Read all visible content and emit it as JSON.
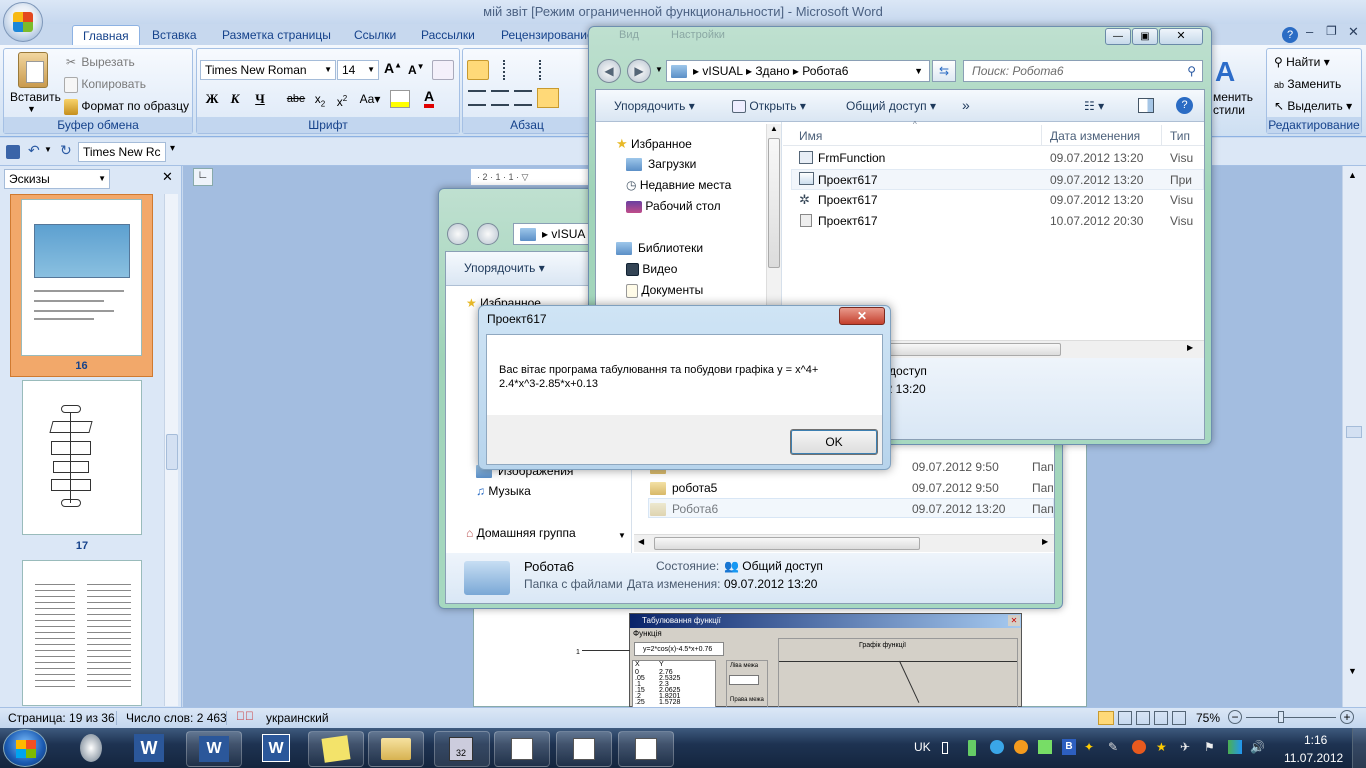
{
  "window": {
    "title": "мій звіт [Режим ограниченной функциональности] - Microsoft Word"
  },
  "ribbon": {
    "tabs": [
      "Главная",
      "Вставка",
      "Разметка страницы",
      "Ссылки",
      "Рассылки",
      "Рецензирование"
    ],
    "clipboard": {
      "paste": "Вставить",
      "cut": "Вырезать",
      "copy": "Копировать",
      "format_painter": "Формат по образцу",
      "label": "Буфер обмена"
    },
    "font": {
      "name": "Times New Roman",
      "size": "14",
      "label": "Шрифт"
    },
    "paragraph": {
      "label": "Абзац"
    },
    "styles": {
      "change": "менить",
      "change2": "стили"
    },
    "editing": {
      "find": "Найти",
      "replace": "Заменить",
      "select": "Выделить",
      "label": "Редактирование"
    }
  },
  "qat": {
    "font_name": "Times New Rc"
  },
  "left_pane": {
    "mode": "Эскизы",
    "pages": [
      "16",
      "17"
    ]
  },
  "explorer1": {
    "path": [
      "vISUAL",
      "Здано",
      "Робота6"
    ],
    "search_placeholder": "Поиск: Робота6",
    "menu": {
      "organize": "Упорядочить",
      "open": "Открыть",
      "share": "Общий доступ",
      "more": "»"
    },
    "nav": {
      "favorites": "Избранное",
      "downloads": "Загрузки",
      "recent": "Недавние места",
      "desktop": "Рабочий стол",
      "libraries": "Библиотеки",
      "video": "Видео",
      "documents": "Документы"
    },
    "columns": {
      "name": "Имя",
      "date": "Дата изменения",
      "type": "Тип"
    },
    "files": [
      {
        "name": "FrmFunction",
        "date": "09.07.2012 13:20",
        "type": "Visu"
      },
      {
        "name": "Проект617",
        "date": "09.07.2012 13:20",
        "type": "При"
      },
      {
        "name": "Проект617",
        "date": "09.07.2012 13:20",
        "type": "Visu"
      },
      {
        "name": "Проект617",
        "date": "10.07.2012 20:30",
        "type": "Visu"
      }
    ],
    "details": {
      "shared": "й доступ",
      "date": "12 13:20"
    },
    "ghost_menu": [
      "Вид",
      "Настройки"
    ]
  },
  "explorer2": {
    "path": "vISUA",
    "menu": {
      "organize": "Упорядочить"
    },
    "nav": {
      "favorites": "Избранное",
      "images": "Изображения",
      "music": "Музыка",
      "homegroup": "Домашняя группа"
    },
    "files": [
      {
        "name": "",
        "date": "09.07.2012 9:50",
        "type": "Пап"
      },
      {
        "name": "робота5",
        "date": "09.07.2012 9:50",
        "type": "Пап"
      },
      {
        "name": "Робота6",
        "date": "09.07.2012 13:20",
        "type": "Пап"
      }
    ],
    "details": {
      "name": "Робота6",
      "kind": "Папка с файлами",
      "state_label": "Состояние:",
      "state_value": "Общий доступ",
      "date_label": "Дата изменения:",
      "date_value": "09.07.2012 13:20"
    }
  },
  "dialog": {
    "title": "Проект617",
    "message_line1": "Вас вітає програма табулювання та побудови графіка y = x^4+",
    "message_line2": "2.4*x^3-2.85*x+0.13",
    "ok": "OK"
  },
  "doc_image": {
    "title": "Табулювання функції",
    "menu": "Функція",
    "formula": "y=2*cos(x)-4.5*x+0.76",
    "lower": "Ліва межа",
    "upper": "Права межа",
    "graph": "Графік функції",
    "col_x": "X",
    "col_y": "Y",
    "x_values": [
      "0",
      ".05",
      ".1",
      ".15",
      ".2",
      ".25"
    ],
    "y_values": [
      "2.76",
      "2.5325",
      "2.3",
      "2.0625",
      "1.8201",
      "1.5728"
    ],
    "marker": "1"
  },
  "status": {
    "page": "Страница: 19 из 36",
    "words": "Число слов: 2 463",
    "lang": "украинский",
    "zoom": "75%"
  },
  "taskbar": {
    "lang": "UK",
    "time": "1:16",
    "date": "11.07.2012"
  }
}
